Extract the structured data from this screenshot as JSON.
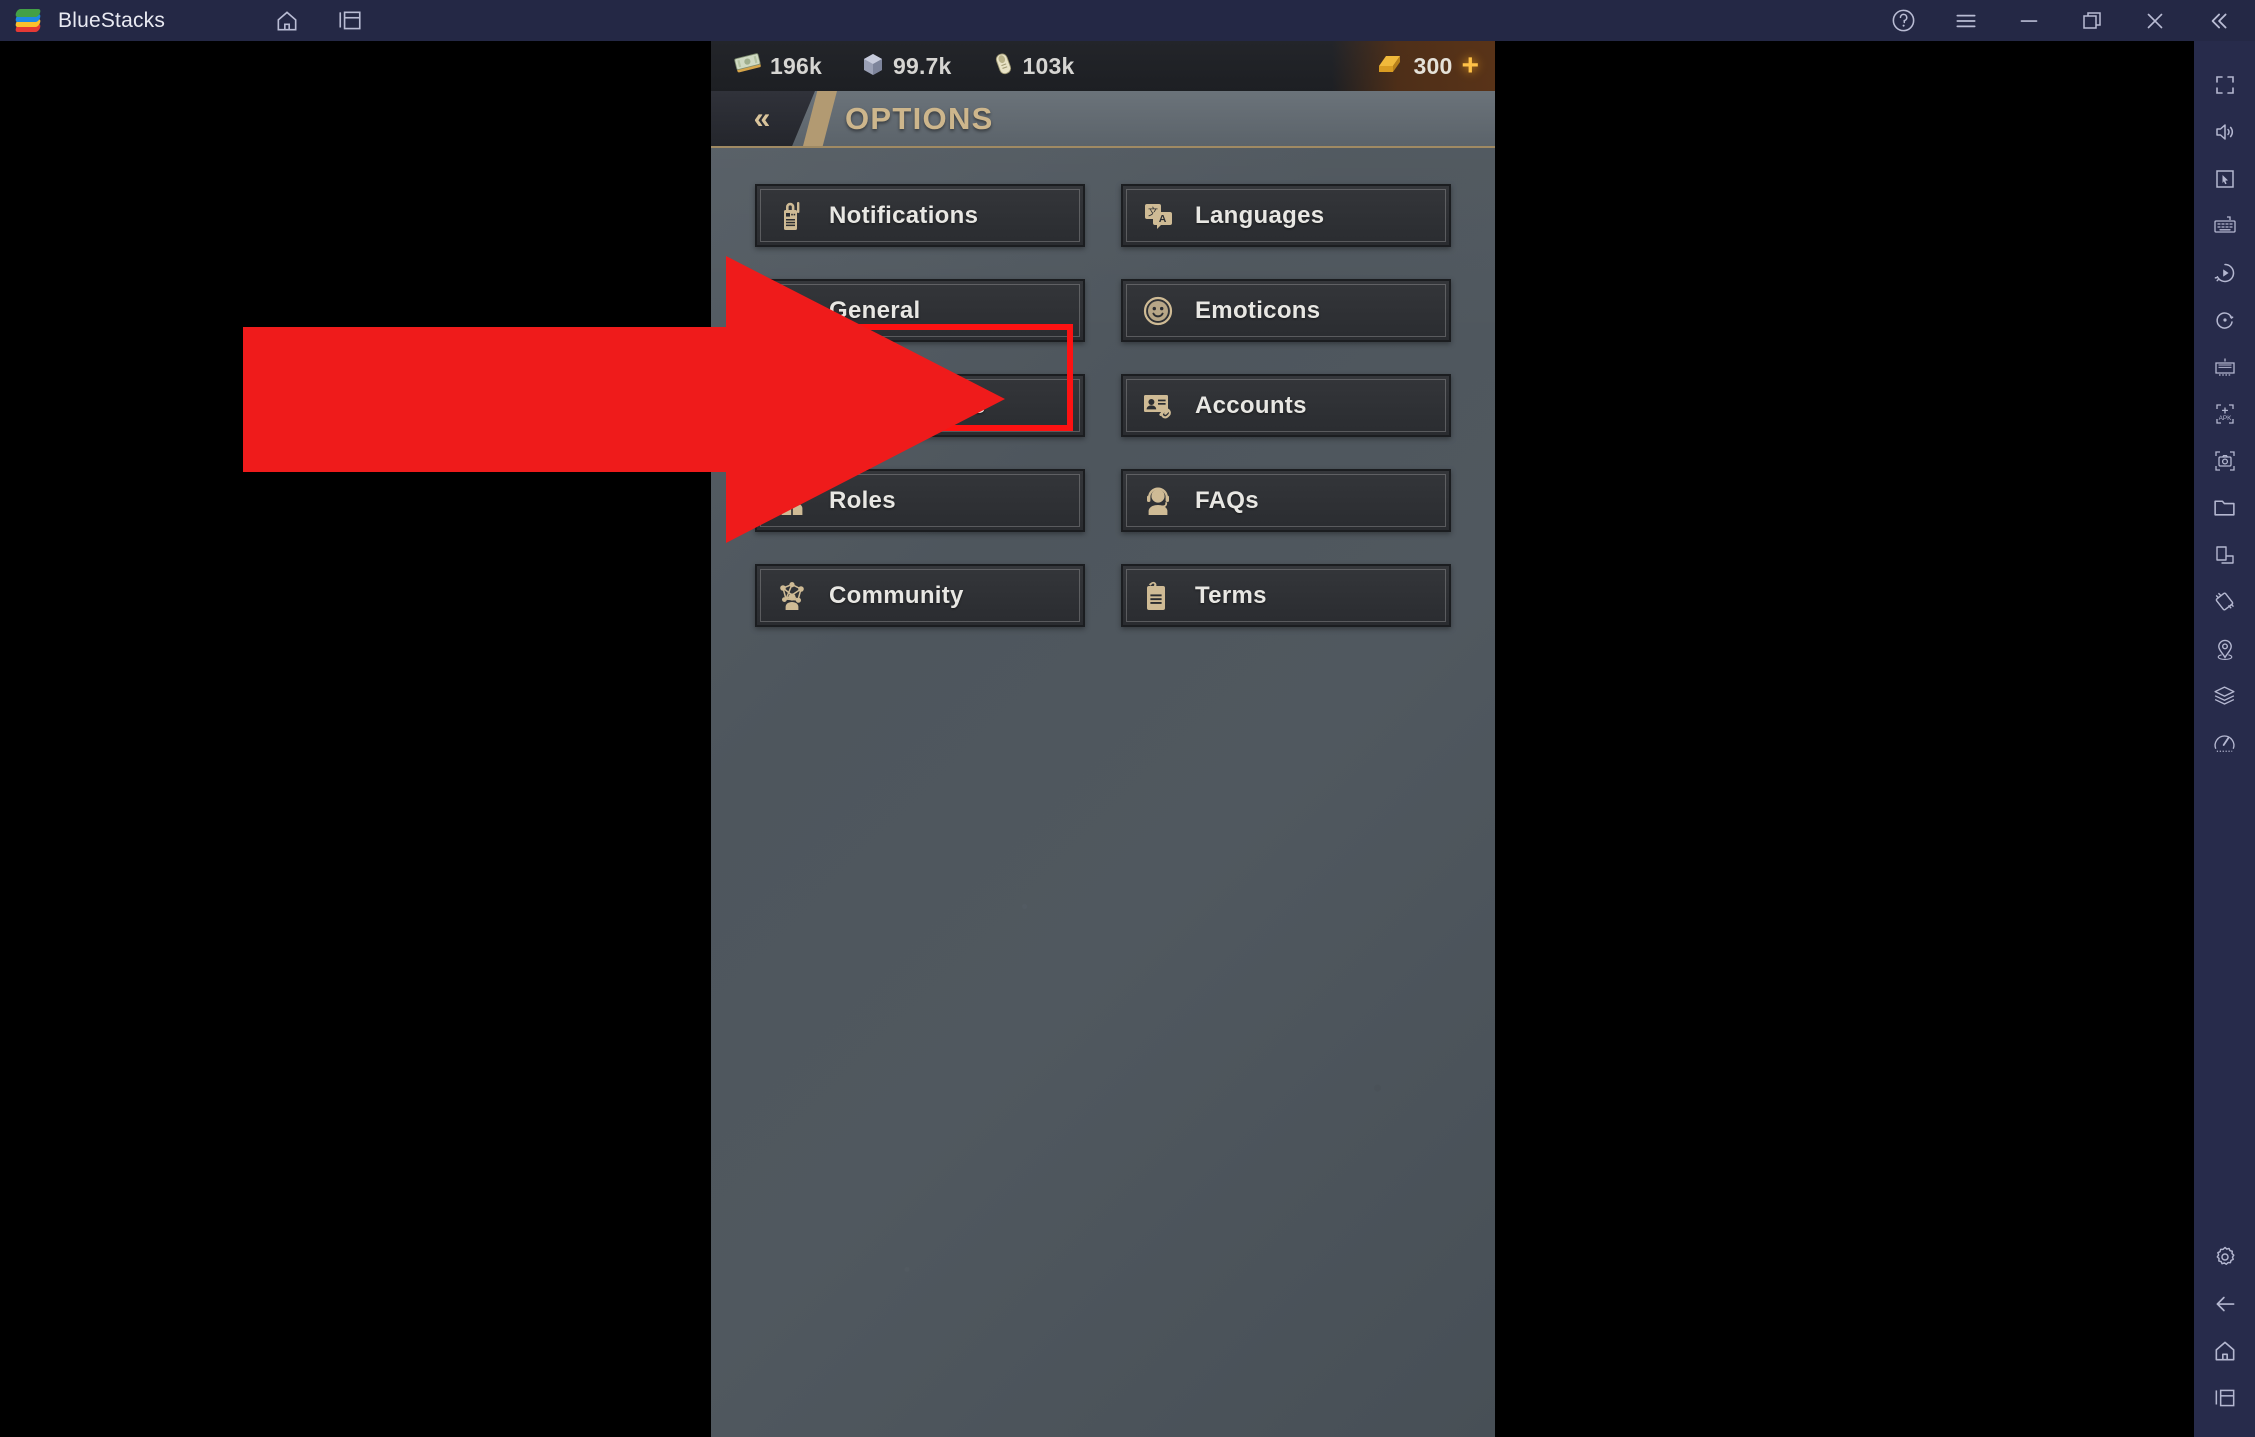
{
  "window": {
    "app_title": "BlueStacks",
    "logo_icon": "bluestacks-logo-icon",
    "titlebar_left_icons": [
      {
        "name": "home-icon",
        "label": "Home"
      },
      {
        "name": "multi-instance-icon",
        "label": "Instance Manager"
      }
    ],
    "titlebar_right_icons": [
      {
        "name": "help-icon",
        "label": "Help"
      },
      {
        "name": "hamburger-menu-icon",
        "label": "Menu"
      },
      {
        "name": "minimize-icon",
        "label": "Minimize"
      },
      {
        "name": "maximize-icon",
        "label": "Maximize"
      },
      {
        "name": "close-icon",
        "label": "Close"
      },
      {
        "name": "collapse-sidebar-icon",
        "label": "Collapse"
      }
    ]
  },
  "sidebar": {
    "top_items": [
      {
        "name": "fullscreen-icon",
        "label": "Fullscreen"
      },
      {
        "name": "volume-icon",
        "label": "Volume"
      },
      {
        "name": "cursor-pointer-icon",
        "label": "Pointer"
      },
      {
        "name": "keyboard-controls-icon",
        "label": "Game controls"
      },
      {
        "name": "macro-recorder-icon",
        "label": "Macro recorder"
      },
      {
        "name": "rotate-icon",
        "label": "Rotate"
      },
      {
        "name": "multi-instance-sync-icon",
        "label": "Multi-instance sync"
      },
      {
        "name": "install-apk-icon",
        "label": "Install APK"
      },
      {
        "name": "screenshot-icon",
        "label": "Screenshot"
      },
      {
        "name": "media-folder-icon",
        "label": "Media manager"
      },
      {
        "name": "screen-record-icon",
        "label": "Screen record"
      },
      {
        "name": "tilt-icon",
        "label": "Tilt control"
      },
      {
        "name": "location-icon",
        "label": "Location"
      },
      {
        "name": "eco-mode-icon",
        "label": "Eco mode"
      },
      {
        "name": "performance-icon",
        "label": "Performance"
      }
    ],
    "bottom_items": [
      {
        "name": "settings-gear-icon",
        "label": "Settings"
      },
      {
        "name": "back-arrow-icon",
        "label": "Back"
      },
      {
        "name": "home-icon",
        "label": "Home"
      },
      {
        "name": "recent-apps-icon",
        "label": "Recent apps"
      }
    ]
  },
  "game": {
    "resources": [
      {
        "name": "cash-icon",
        "icon": "cash-stack",
        "value": "196k"
      },
      {
        "name": "metal-icon",
        "icon": "metal-ingot",
        "value": "99.7k"
      },
      {
        "name": "food-icon",
        "icon": "food-roll",
        "value": "103k"
      }
    ],
    "premium": {
      "icon": "gold-icon",
      "value": "300",
      "add_label": "+"
    },
    "header": {
      "back_label": "«",
      "title": "OPTIONS"
    },
    "options": [
      {
        "id": "notifications",
        "label": "Notifications",
        "icon": "walkie-talkie-icon",
        "column": "left"
      },
      {
        "id": "languages",
        "label": "Languages",
        "icon": "translate-icon",
        "column": "right"
      },
      {
        "id": "general",
        "label": "General",
        "icon": "gear-icon",
        "column": "left"
      },
      {
        "id": "emoticons",
        "label": "Emoticons",
        "icon": "smiley-face-icon",
        "column": "right"
      },
      {
        "id": "commanders",
        "label": "Commanders",
        "icon": "commander-search-icon",
        "column": "left"
      },
      {
        "id": "accounts",
        "label": "Accounts",
        "icon": "id-card-link-icon",
        "column": "right"
      },
      {
        "id": "roles",
        "label": "Roles",
        "icon": "officer-icon",
        "column": "left"
      },
      {
        "id": "faqs",
        "label": "FAQs",
        "icon": "headset-support-icon",
        "column": "right"
      },
      {
        "id": "community",
        "label": "Community",
        "icon": "social-network-icon",
        "column": "left"
      },
      {
        "id": "terms",
        "label": "Terms",
        "icon": "document-clipboard-icon",
        "column": "right"
      }
    ]
  },
  "annotation": {
    "highlight_target": "general",
    "highlight_color": "#fd1212",
    "arrow_color": "#ef1b1b",
    "arrow_direction": "right"
  }
}
